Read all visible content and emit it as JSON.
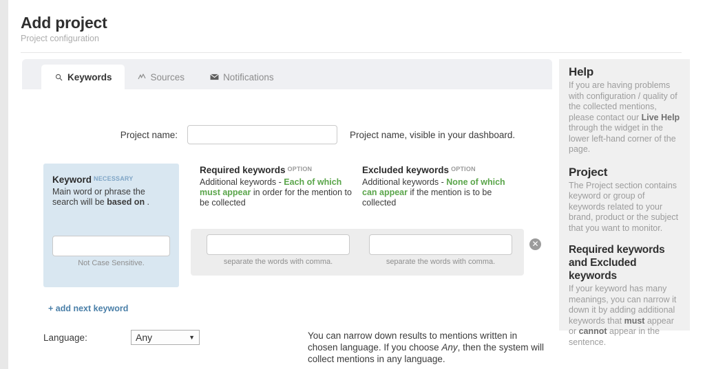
{
  "header": {
    "title": "Add project",
    "subtitle": "Project configuration"
  },
  "tabs": [
    {
      "label": "Keywords",
      "icon": "search-icon",
      "glyph": "⌕",
      "active": true
    },
    {
      "label": "Sources",
      "icon": "pulse-icon",
      "glyph": "∿",
      "active": false
    },
    {
      "label": "Notifications",
      "icon": "envelope-icon",
      "glyph": "✉",
      "active": false
    }
  ],
  "form": {
    "project_name": {
      "label": "Project name:",
      "value": "",
      "placeholder": "",
      "hint": "Project name, visible in your dashboard."
    },
    "keyword": {
      "title": "Keyword",
      "badge": "NECESSARY",
      "desc_1": "Main word or phrase the search will be ",
      "desc_bold": "based on",
      "desc_2": " .",
      "value": "",
      "placeholder": "",
      "sub_hint": "Not Case Sensitive."
    },
    "required_keywords": {
      "title": "Required keywords",
      "badge": "OPTION",
      "desc_1": "Additional keywords - ",
      "desc_green": "Each of which must appear",
      "desc_2": " in order for the mention to be collected",
      "value": "",
      "placeholder": "",
      "sub_hint": "separate the words with comma."
    },
    "excluded_keywords": {
      "title": "Excluded keywords",
      "badge": "OPTION",
      "desc_1": "Additional keywords - ",
      "desc_green": "None of which can appear",
      "desc_2": " if the mention is to be collected",
      "value": "",
      "placeholder": "",
      "sub_hint": "separate the words with comma."
    },
    "remove_row": {
      "glyph": "✕"
    },
    "add_next_keyword": "+ add next keyword",
    "language": {
      "label": "Language:",
      "selected": "Any",
      "options": [
        "Any"
      ],
      "caret": "▼",
      "hint_1": "You can narrow down results to mentions written in chosen language. If you choose ",
      "hint_italic": "Any",
      "hint_2": ", then the system will collect mentions in any language."
    }
  },
  "help": {
    "sections": [
      {
        "heading": "Help",
        "text_1": "If you are having problems with configuration / quality of the collected mentions, please contact our ",
        "text_bold": "Live Help",
        "text_2": " through the widget in the lower left-hand corner of the page."
      },
      {
        "heading": "Project",
        "text_1": "The Project section contains keyword or group of keywords related to your brand, product or the subject that you want to monitor.",
        "text_bold": "",
        "text_2": ""
      },
      {
        "heading": "Required keywords and Excluded keywords",
        "text_1": "If your keyword has many meanings, you can narrow it down it by adding additional keywords that ",
        "text_bold": "must",
        "text_2": " appear or ",
        "text_bold2": "cannot",
        "text_3": " appear in the sentence."
      }
    ]
  },
  "colors": {
    "accent_blue": "#4a7fa8",
    "keyword_box": "#d9e7f1",
    "green": "#5aa54a",
    "band_gray": "#ededed",
    "help_gray": "#f0f0f0"
  }
}
